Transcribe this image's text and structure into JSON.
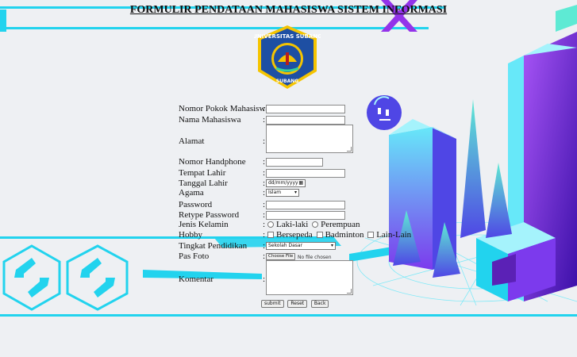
{
  "page": {
    "title": "FORMULIR PENDATAAN MAHASISWA SISTEM INFORMASI"
  },
  "logo": {
    "arc_text": "UNIVERSITAS SUBANG",
    "bottom_text": "SUBANG"
  },
  "form": {
    "npm": {
      "label": "Nomor Pokok Mahasiswa",
      "sep": ":"
    },
    "nama": {
      "label": "Nama Mahasiswa",
      "sep": ":"
    },
    "alamat": {
      "label": "Alamat",
      "sep": ":"
    },
    "hp": {
      "label": "Nomor Handphone",
      "sep": ":"
    },
    "tempat_lahir": {
      "label": "Tempat Lahir",
      "sep": ":"
    },
    "tanggal_lahir": {
      "label": "Tanggal Lahir",
      "sep": ":",
      "placeholder": "dd/mm/yyyy"
    },
    "agama": {
      "label": "Agama",
      "sep": ":",
      "selected": "Islam"
    },
    "password": {
      "label": "Password",
      "sep": ":"
    },
    "retype_password": {
      "label": "Retype Password",
      "sep": ":"
    },
    "jenis_kelamin": {
      "label": "Jenis Kelamin",
      "sep": ":",
      "options": [
        "Laki-laki",
        "Perempuan"
      ]
    },
    "hobby": {
      "label": "Hobby",
      "sep": ":",
      "options": [
        "Bersepeda",
        "Badminton",
        "Lain-Lain"
      ]
    },
    "pendidikan": {
      "label": "Tingkat Pendidikan",
      "sep": ":",
      "selected": "Sekolah Dasar"
    },
    "foto": {
      "label": "Pas Foto",
      "sep": ":",
      "button": "Choose File",
      "status": "No file chosen"
    },
    "komentar": {
      "label": "Komentar",
      "sep": ":"
    },
    "buttons": {
      "submit": "submit",
      "reset": "Reset",
      "back": "Back"
    }
  },
  "colors": {
    "accent_cyan": "#22d3ee",
    "purple": "#6d28d9",
    "magenta": "#9333ea",
    "logo_blue": "#1e4fa3",
    "logo_yellow": "#f5c400"
  }
}
